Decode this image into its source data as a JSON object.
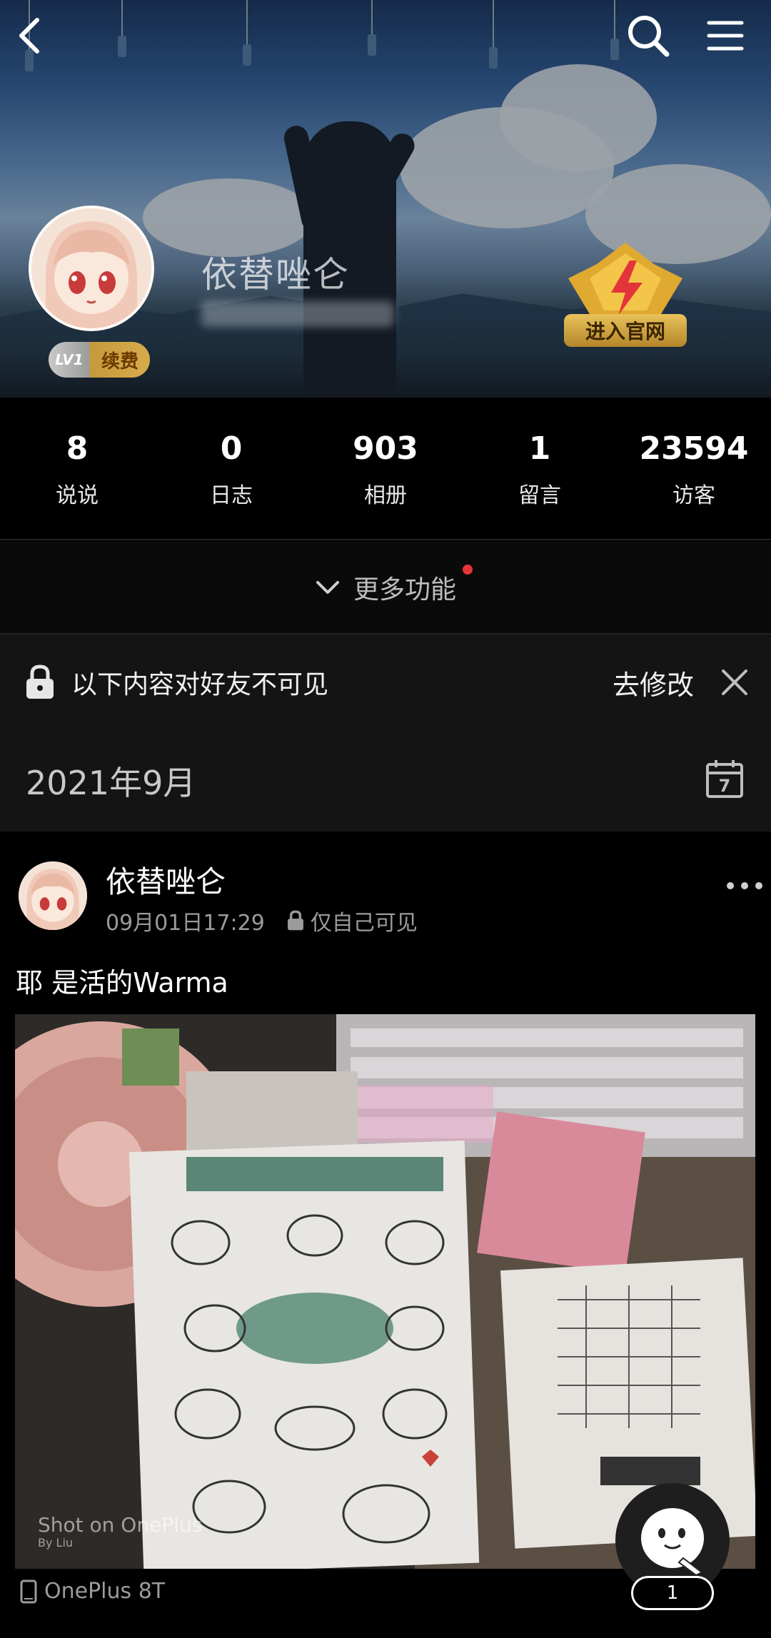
{
  "header": {
    "back_icon": "back-arrow-icon",
    "search_icon": "search-icon",
    "menu_icon": "menu-icon",
    "profile_name": "依替唑仑",
    "level": "LV1",
    "renew_label": "续费",
    "vip_label": "进入官网"
  },
  "stats": [
    {
      "value": "8",
      "label": "说说"
    },
    {
      "value": "0",
      "label": "日志"
    },
    {
      "value": "903",
      "label": "相册"
    },
    {
      "value": "1",
      "label": "留言"
    },
    {
      "value": "23594",
      "label": "访客"
    }
  ],
  "more_features": {
    "label": "更多功能",
    "has_notification": true
  },
  "privacy_notice": {
    "message": "以下内容对好友不可见",
    "action": "去修改"
  },
  "timeline": {
    "month": "2021年9月",
    "calendar_day": "7"
  },
  "post": {
    "author": "依替唑仑",
    "datetime": "09月01日17:29",
    "visibility": "仅自己可见",
    "text": "耶 是活的Warma",
    "photo_watermark": "Shot on OnePlus",
    "photo_watermark_sub": "By Liu",
    "device": "OnePlus 8T"
  },
  "fab": {
    "count": "1"
  },
  "colors": {
    "background": "#000000",
    "notification_dot": "#e8333a",
    "vip_gold": "#d7ac4c"
  }
}
